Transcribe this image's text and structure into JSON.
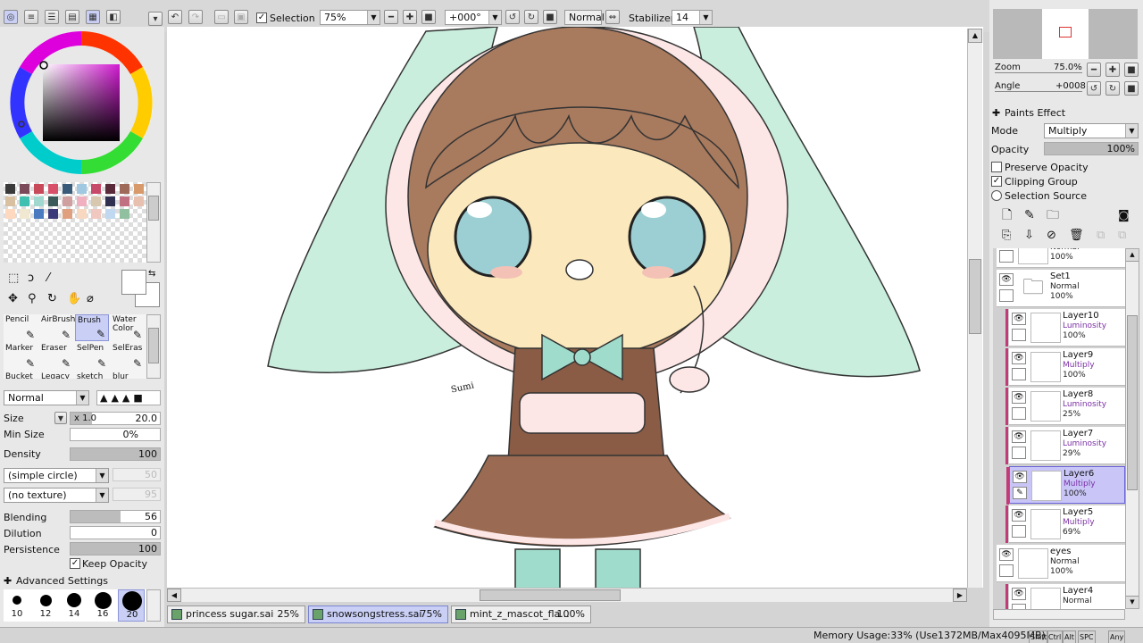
{
  "toolbar": {
    "selection_label": "Selection",
    "selection_checked": true,
    "zoom_value": "75%",
    "angle_value": "+000°",
    "blend_mode": "Normal",
    "stabilizer_label": "Stabilizer",
    "stabilizer_value": "14"
  },
  "color_panel": {
    "hue_ring": "color-wheel",
    "current_color": "#5a1a46"
  },
  "palette": {
    "swatches": [
      "#3a3a3a",
      "#7a4a5a",
      "#c84a5a",
      "#d8506a",
      "#3a5a7a",
      "#a0c8e0",
      "#c84a6a",
      "#5a2a3a",
      "#a06a5a",
      "#d89a6a",
      "#d8c0a0",
      "#40c0b0",
      "#a0d8d0",
      "#3a5a5a",
      "#d0a0a0",
      "#f0b0c0",
      "#d8c8b0",
      "#303050",
      "#c07080",
      "#e8c0b0",
      "#ffd8c0",
      "#f0e8d0",
      "#4a7ac0",
      "#3a3a7a",
      "#e0a080",
      "#f8d8c0",
      "#f0c8c0",
      "#c0d8f0",
      "#90c0a0"
    ]
  },
  "tools": [
    {
      "label": "Pencil",
      "icon": "pencil-icon",
      "active": false
    },
    {
      "label": "AirBrush",
      "icon": "airbrush-icon",
      "active": false
    },
    {
      "label": "Brush",
      "icon": "brush-icon",
      "active": true
    },
    {
      "label": "Water Color",
      "icon": "watercolor-icon",
      "active": false
    },
    {
      "label": "Marker",
      "icon": "marker-icon",
      "active": false
    },
    {
      "label": "Eraser",
      "icon": "eraser-icon",
      "active": false
    },
    {
      "label": "SelPen",
      "icon": "selpen-icon",
      "active": false
    },
    {
      "label": "SelEras",
      "icon": "seleras-icon",
      "active": false
    },
    {
      "label": "Bucket",
      "icon": "bucket-icon",
      "active": false
    },
    {
      "label": "Legacy",
      "icon": "legacy-icon",
      "active": false
    },
    {
      "label": "sketch",
      "icon": "sketch-icon",
      "active": false
    },
    {
      "label": "blur",
      "icon": "blur-icon",
      "active": false
    }
  ],
  "brush_settings": {
    "blend_mode": "Normal",
    "size_label": "Size",
    "size_multiplier": "x 1.0",
    "size_value": "20.0",
    "min_size_label": "Min Size",
    "min_size_value": "0%",
    "density_label": "Density",
    "density_value": "100",
    "shape": "(simple circle)",
    "shape_value": "50",
    "texture": "(no texture)",
    "texture_value": "95",
    "blending_label": "Blending",
    "blending_value": "56",
    "dilution_label": "Dilution",
    "dilution_value": "0",
    "persistence_label": "Persistence",
    "persistence_value": "100",
    "keep_opacity_label": "Keep Opacity",
    "keep_opacity_checked": true,
    "advanced_label": "Advanced Settings"
  },
  "brush_sizes": [
    "10",
    "12",
    "14",
    "16",
    "20"
  ],
  "navigator": {
    "zoom_label": "Zoom",
    "zoom_value": "75.0%",
    "angle_label": "Angle",
    "angle_value": "+0008"
  },
  "layer_props": {
    "paints_effect_label": "Paints Effect",
    "mode_label": "Mode",
    "mode_value": "Multiply",
    "opacity_label": "Opacity",
    "opacity_value": "100%",
    "preserve_opacity_label": "Preserve Opacity",
    "preserve_opacity_checked": false,
    "clipping_group_label": "Clipping Group",
    "clipping_group_checked": true,
    "selection_source_label": "Selection Source",
    "selection_source_checked": false
  },
  "layers": [
    {
      "name": "",
      "mode": "Normal",
      "opacity": "100%",
      "clip": false,
      "selected": false,
      "folder": false,
      "top_partial": true
    },
    {
      "name": "Set1",
      "mode": "Normal",
      "opacity": "100%",
      "clip": false,
      "selected": false,
      "folder": true
    },
    {
      "name": "Layer10",
      "mode": "Luminosity",
      "opacity": "100%",
      "clip": true,
      "selected": false,
      "folder": false
    },
    {
      "name": "Layer9",
      "mode": "Multiply",
      "opacity": "100%",
      "clip": true,
      "selected": false,
      "folder": false
    },
    {
      "name": "Layer8",
      "mode": "Luminosity",
      "opacity": "25%",
      "clip": true,
      "selected": false,
      "folder": false,
      "hover": true
    },
    {
      "name": "Layer7",
      "mode": "Luminosity",
      "opacity": "29%",
      "clip": true,
      "selected": false,
      "folder": false
    },
    {
      "name": "Layer6",
      "mode": "Multiply",
      "opacity": "100%",
      "clip": true,
      "selected": true,
      "folder": false
    },
    {
      "name": "Layer5",
      "mode": "Multiply",
      "opacity": "69%",
      "clip": true,
      "selected": false,
      "folder": false
    },
    {
      "name": "eyes",
      "mode": "Normal",
      "opacity": "100%",
      "clip": false,
      "selected": false,
      "folder": false
    },
    {
      "name": "Layer4",
      "mode": "Normal",
      "opacity": "",
      "clip": true,
      "selected": false,
      "folder": false
    }
  ],
  "canvas": {
    "signature": "Sumi"
  },
  "doc_tabs": [
    {
      "name": "princess sugar.sai",
      "zoom": "25%",
      "active": false
    },
    {
      "name": "snowsongstress.sai",
      "zoom": "75%",
      "active": true
    },
    {
      "name": "mint_z_mascot_fla...",
      "zoom": "100%",
      "active": false
    }
  ],
  "status": {
    "memory": "Memory Usage:33% (Use1372MB/Max4095MB)",
    "keys": [
      "Shift",
      "Ctrl",
      "Alt",
      "SPC",
      "Any"
    ]
  }
}
